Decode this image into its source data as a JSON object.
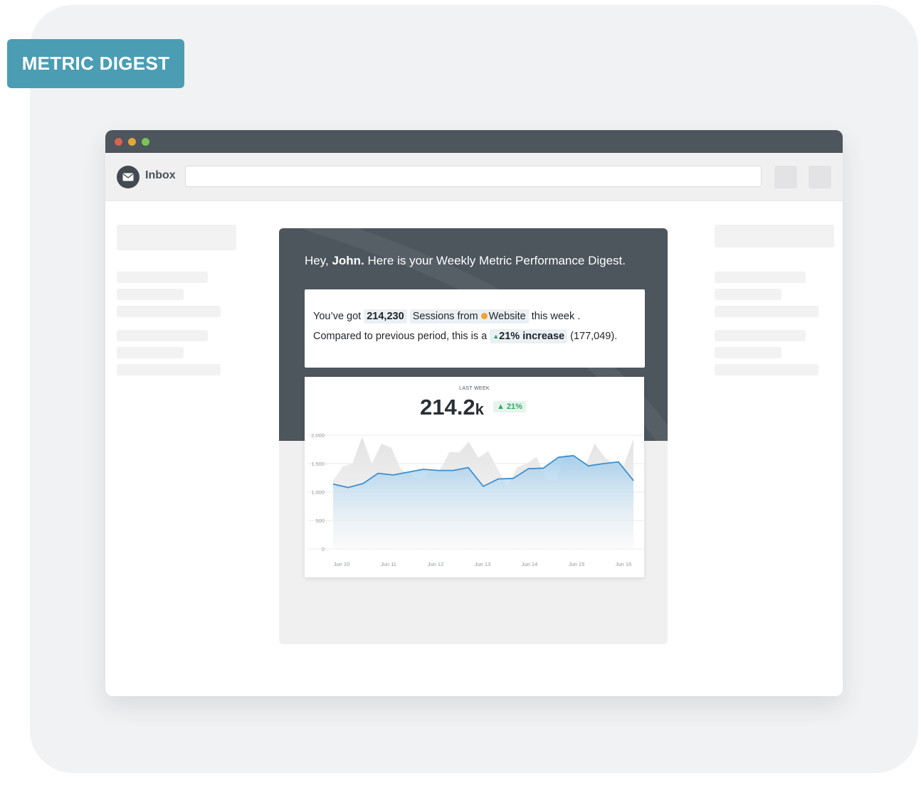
{
  "badge": {
    "label": "METRIC DIGEST"
  },
  "window": {
    "traffic_lights": [
      "#d9624d",
      "#e5a53a",
      "#7cc257"
    ],
    "toolbar": {
      "inbox_label": "Inbox",
      "mail_icon": "envelope-icon",
      "address_value": ""
    }
  },
  "email": {
    "greeting_prefix": "Hey,",
    "greeting_name": "John.",
    "greeting_suffix": "Here is your Weekly Metric Performance Digest.",
    "summary": {
      "line1_prefix": "You’ve got",
      "value": "214,230",
      "metric": "Sessions from",
      "source_icon": "website-dot-icon",
      "source": "Website",
      "period": "this week .",
      "line2_prefix": "Compared to previous period, this is a",
      "change_icon": "triangle-up-icon",
      "change": "21% increase",
      "previous": "(177,049)."
    },
    "chart_card": {
      "caption": "LAST WEEK",
      "big_number": "214.2",
      "big_suffix": "k",
      "change_badge": "▲ 21%"
    }
  },
  "colors": {
    "badge": "#4b9db4",
    "header": "#4d555d",
    "line": "#3b8fd0",
    "positive": "#36a269"
  },
  "chart_data": {
    "type": "area",
    "ylim": [
      0,
      2000
    ],
    "y_ticks": [
      0,
      500,
      1000,
      1500,
      2000
    ],
    "y_tick_labels": [
      "0",
      "500",
      "1,000",
      "1,500",
      "2,000"
    ],
    "x_tick_positions": [
      0.5,
      3.5,
      6.5,
      9.5,
      12.5,
      15.5,
      18.5
    ],
    "x_tick_labels": [
      "Jun 10",
      "Jun 11",
      "Jun 12",
      "Jun 13",
      "Jun 14",
      "Jun 15",
      "Jun 16"
    ],
    "grid": true,
    "series": [
      {
        "role": "previous",
        "values": [
          1200,
          1450,
          1500,
          1970,
          1500,
          1850,
          1780,
          1400,
          1300,
          1200,
          1350,
          1380,
          1700,
          1700,
          1880,
          1600,
          1720,
          1400,
          1100,
          1440,
          1500,
          1620,
          1220,
          1200,
          1670,
          1550,
          1450,
          1850,
          1620,
          1480,
          1470,
          1930
        ]
      },
      {
        "role": "current",
        "values": [
          1140,
          1080,
          1150,
          1330,
          1300,
          1350,
          1400,
          1380,
          1380,
          1430,
          1100,
          1230,
          1240,
          1410,
          1420,
          1610,
          1640,
          1460,
          1500,
          1530,
          1200
        ]
      }
    ]
  }
}
